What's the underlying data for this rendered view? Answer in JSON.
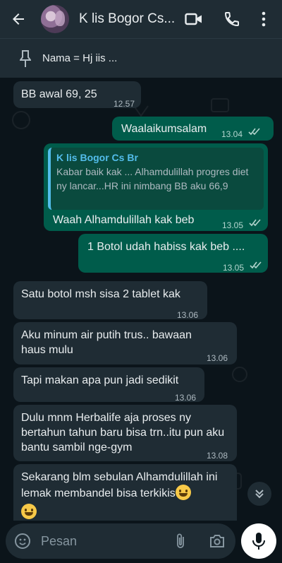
{
  "header": {
    "title": "K lis Bogor Cs...",
    "icons": [
      "back-arrow-icon",
      "video-call-icon",
      "voice-call-icon",
      "more-options-icon"
    ]
  },
  "pinned": {
    "text": "Nama = Hj iis ..."
  },
  "messages": [
    {
      "dir": "in",
      "text": "BB awal 69, 25",
      "time": "12.57"
    },
    {
      "dir": "out",
      "text": "Waalaikumsalam",
      "time": "13.04"
    },
    {
      "dir": "out",
      "quote_name": "K lis Bogor Cs Br",
      "quote_text": "Kabar baik kak ... Alhamdulillah progres diet ny lancar...HR ini nimbang BB aku 66,9",
      "text": "Waah Alhamdulillah kak beb",
      "time": "13.05"
    },
    {
      "dir": "out",
      "text": "1 Botol udah habiss kak beb ....",
      "time": "13.05"
    },
    {
      "dir": "in",
      "text": "Satu botol msh sisa 2 tablet kak",
      "time": "13.06"
    },
    {
      "dir": "in",
      "text": "Aku minum air putih trus.. bawaan haus mulu",
      "time": "13.06"
    },
    {
      "dir": "in",
      "text": "Tapi makan apa pun jadi sedikit",
      "time": "13.06"
    },
    {
      "dir": "in",
      "text": "Dulu mnm Herbalife aja proses ny bertahun tahun baru bisa trn..itu pun aku bantu sambil nge-gym",
      "time": "13.08"
    },
    {
      "dir": "in",
      "text": "Sekarang blm sebulan Alhamdulillah ini lemak membandel bisa terkikis"
    }
  ],
  "composer": {
    "placeholder": "Pesan",
    "icons": [
      "sticker-icon",
      "attach-icon",
      "camera-icon",
      "mic-icon"
    ]
  },
  "colors": {
    "header_bg": "#1f2c34",
    "chat_bg": "#0b141a",
    "incoming_bubble": "#1f2c34",
    "outgoing_bubble": "#005c4b",
    "read_ticks": "#53bdeb"
  }
}
